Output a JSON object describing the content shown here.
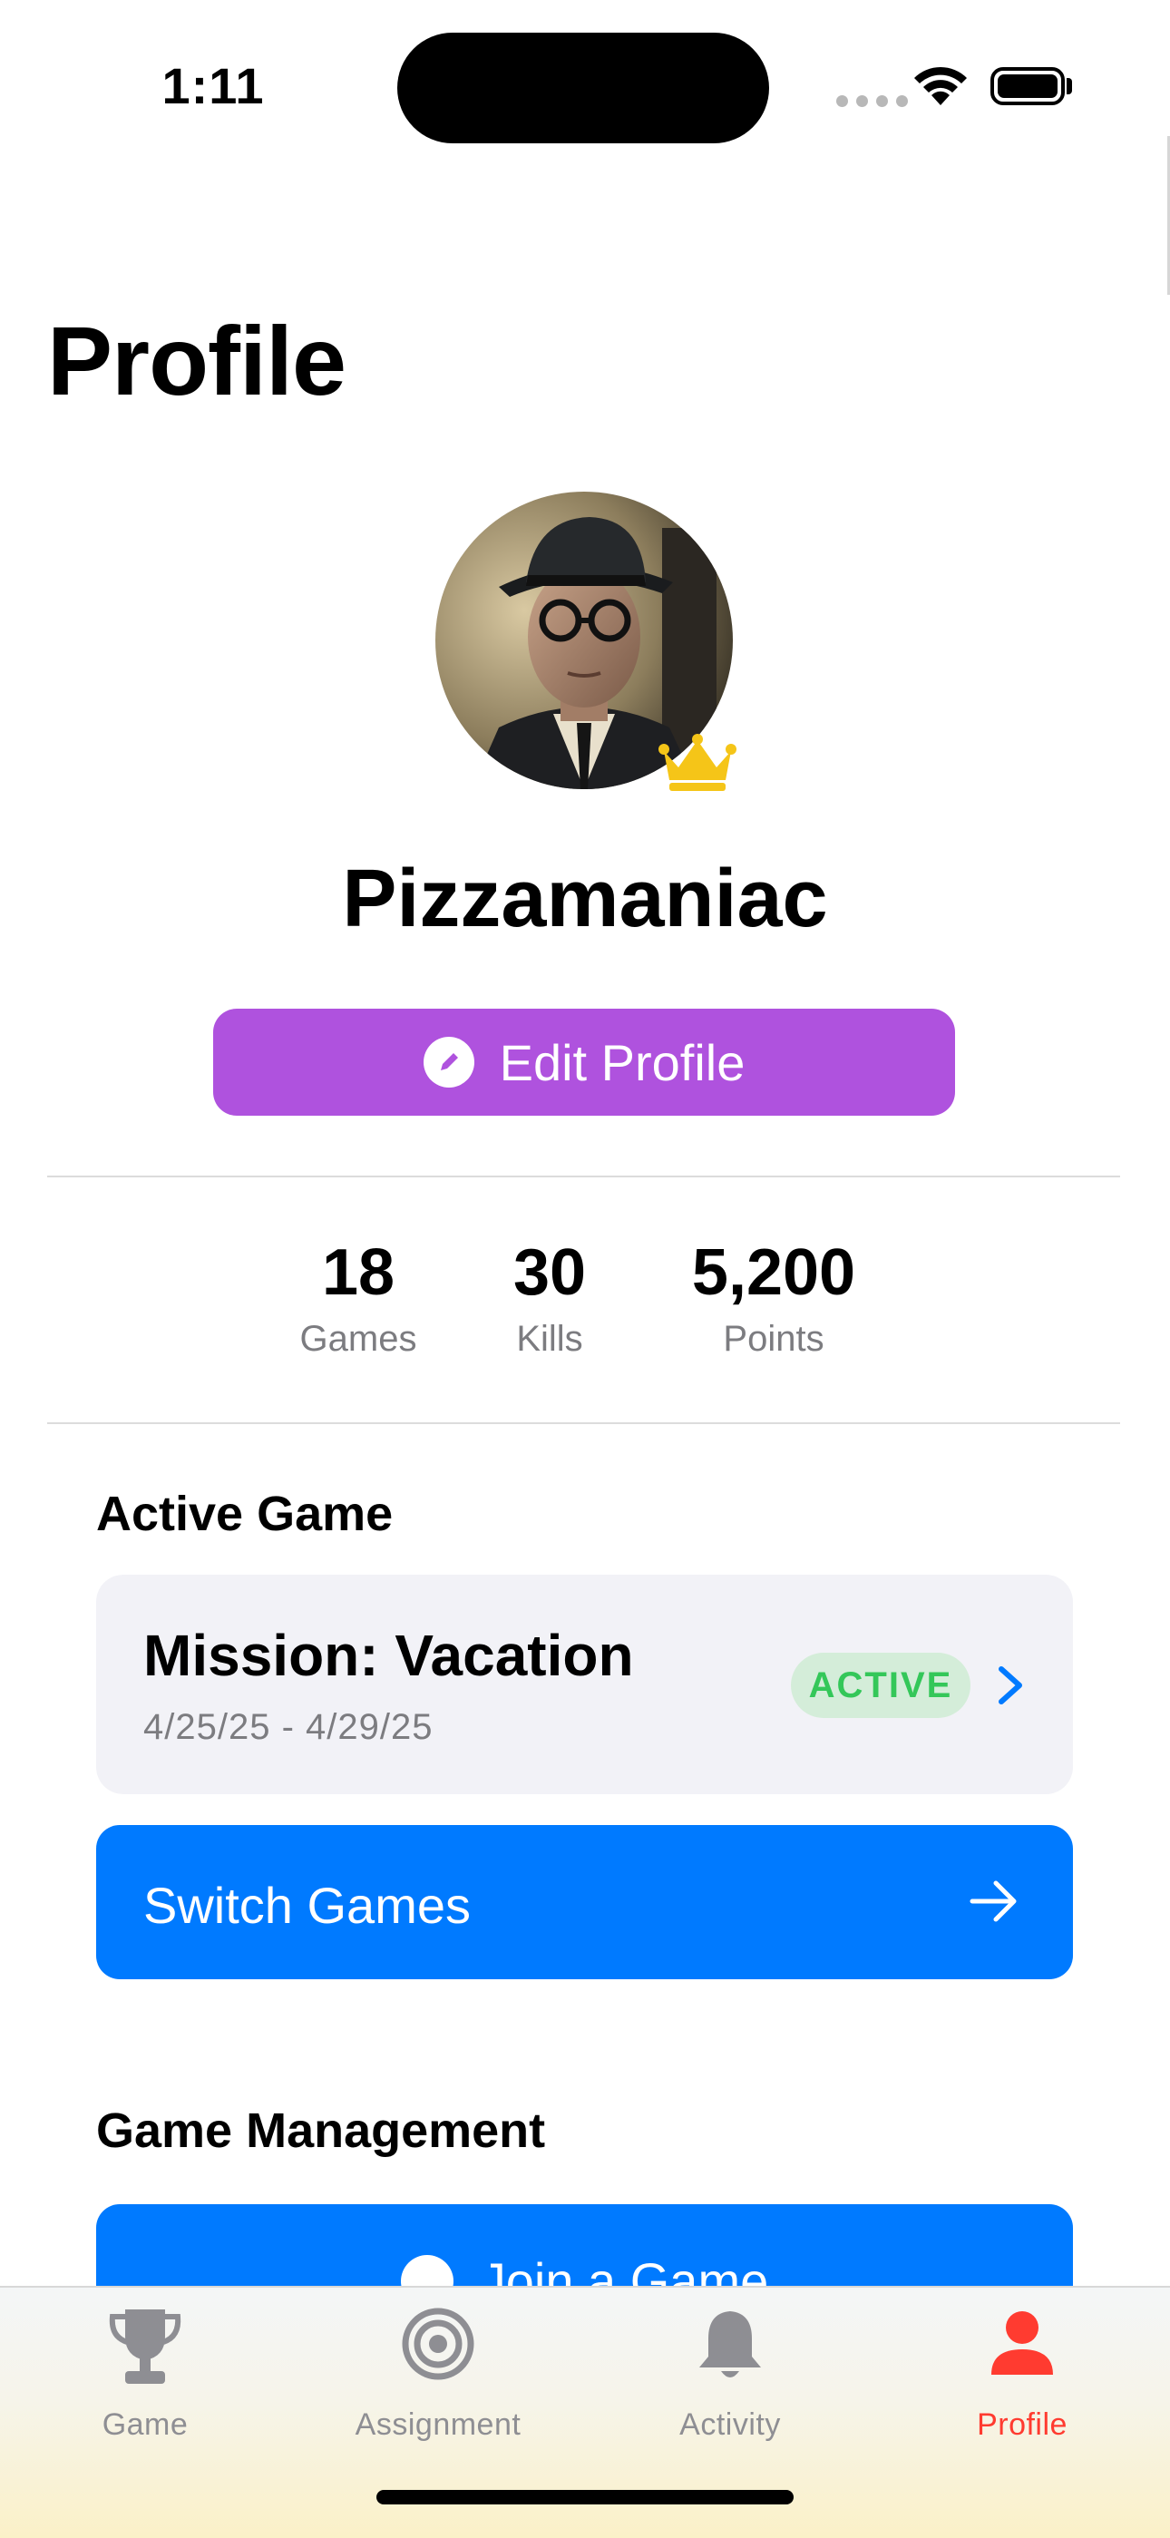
{
  "status_bar": {
    "time": "1:11"
  },
  "header": {
    "title": "Profile"
  },
  "profile": {
    "username": "Pizzamaniac",
    "edit_label": "Edit Profile"
  },
  "stats": [
    {
      "value": "18",
      "label": "Games"
    },
    {
      "value": "30",
      "label": "Kills"
    },
    {
      "value": "5,200",
      "label": "Points"
    }
  ],
  "active_game": {
    "section_title": "Active Game",
    "name": "Mission: Vacation",
    "dates": "4/25/25 - 4/29/25",
    "status": "ACTIVE",
    "switch_label": "Switch Games"
  },
  "game_management": {
    "section_title": "Game Management",
    "join_label": "Join a Game"
  },
  "tab_bar": {
    "tabs": [
      {
        "label": "Game",
        "icon": "trophy-icon"
      },
      {
        "label": "Assignment",
        "icon": "target-icon"
      },
      {
        "label": "Activity",
        "icon": "bell-icon"
      },
      {
        "label": "Profile",
        "icon": "person-icon"
      }
    ],
    "selected": "Profile"
  },
  "colors": {
    "accent_purple": "#af52de",
    "primary_blue": "#007aff",
    "active_green": "#34c759",
    "tab_active": "#ff3b30",
    "tab_inactive": "#8e8e93",
    "crown_gold": "#f5c518"
  }
}
